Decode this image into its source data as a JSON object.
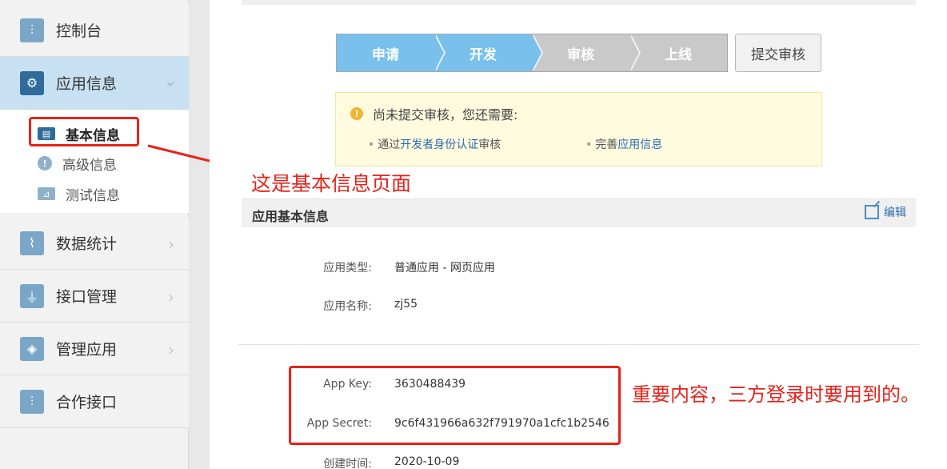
{
  "sidebar": {
    "items": [
      {
        "label": "控制台",
        "icon": "sliders-icon"
      },
      {
        "label": "应用信息",
        "icon": "gear-icon"
      },
      {
        "label": "数据统计",
        "icon": "chart-icon"
      },
      {
        "label": "接口管理",
        "icon": "plug-icon"
      },
      {
        "label": "管理应用",
        "icon": "layers-icon"
      },
      {
        "label": "合作接口",
        "icon": "sliders-icon"
      }
    ],
    "sub_items": [
      {
        "label": "基本信息",
        "icon": "card-icon"
      },
      {
        "label": "高级信息",
        "icon": "info-icon"
      },
      {
        "label": "测试信息",
        "icon": "test-icon"
      }
    ]
  },
  "steps": [
    "申请",
    "开发",
    "审核",
    "上线"
  ],
  "submit_label": "提交审核",
  "notice": {
    "title": "尚未提交审核，您还需要:",
    "req1_prefix": "通过",
    "req1_link": "开发者身份认证",
    "req1_suffix": "审核",
    "req2_prefix": "完善",
    "req2_link": "应用信息"
  },
  "annotation_page": "这是基本信息页面",
  "annotation_key": "重要内容，三方登录时要用到的。",
  "section": {
    "title": "应用基本信息",
    "edit_label": "编辑"
  },
  "fields": {
    "app_type_label": "应用类型:",
    "app_type_value": "普通应用   -   网页应用",
    "app_name_label": "应用名称:",
    "app_name_value": "zj55",
    "app_key_label": "App Key:",
    "app_key_value": "3630488439",
    "app_secret_label": "App Secret:",
    "app_secret_value": "9c6f431966a632f791970a1cfc1b2546",
    "created_label": "创建时间:",
    "created_value": "2020-10-09"
  },
  "colors": {
    "accent": "#79c0ec",
    "sidebar_active": "#c7e1f2",
    "annotation_red": "#e3241c",
    "link": "#2f6cac"
  }
}
